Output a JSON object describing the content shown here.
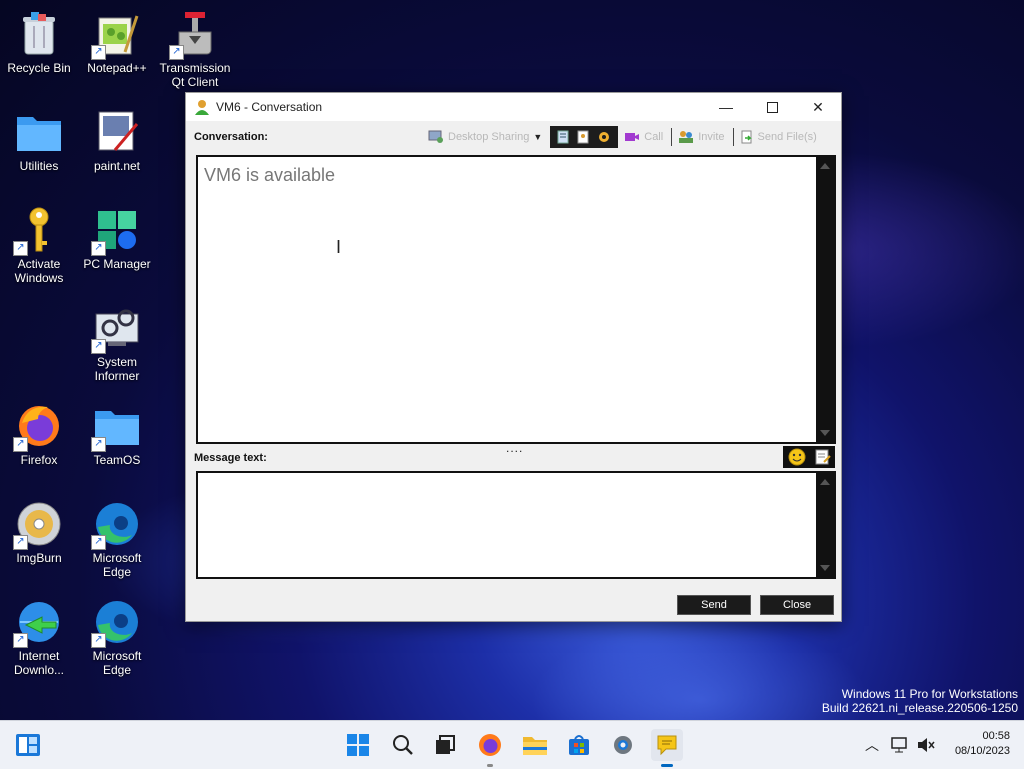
{
  "desktop": {
    "icons": [
      {
        "label": "Recycle Bin",
        "icon": "recycle-bin-icon"
      },
      {
        "label": "Notepad++",
        "icon": "notepad-plus-icon"
      },
      {
        "label": "Transmission Qt Client",
        "icon": "transmission-icon"
      },
      {
        "label": "Utilities",
        "icon": "folder-icon"
      },
      {
        "label": "paint.net",
        "icon": "paintnet-icon"
      },
      {
        "label": "Activate Windows",
        "icon": "key-icon"
      },
      {
        "label": "PC Manager",
        "icon": "pc-manager-icon"
      },
      {
        "label": "System Informer",
        "icon": "system-informer-icon"
      },
      {
        "label": "Firefox",
        "icon": "firefox-icon"
      },
      {
        "label": "TeamOS",
        "icon": "folder-icon"
      },
      {
        "label": "ImgBurn",
        "icon": "imgburn-icon"
      },
      {
        "label": "Microsoft Edge",
        "icon": "edge-icon"
      },
      {
        "label": "Internet Downlo...",
        "icon": "idm-icon"
      },
      {
        "label": "Microsoft Edge",
        "icon": "edge-icon"
      }
    ],
    "watermark_line1": "Windows 11 Pro for Workstations",
    "watermark_line2": "Build 22621.ni_release.220506-1250"
  },
  "window": {
    "title": "VM6 - Conversation",
    "conversation_label": "Conversation:",
    "message_label": "Message text:",
    "conversation_text": "VM6 is available",
    "message_value": "",
    "toolbar": {
      "desktop_sharing": "Desktop Sharing",
      "call": "Call",
      "invite": "Invite",
      "send_files": "Send File(s)"
    },
    "send_label": "Send",
    "close_label": "Close",
    "resize_grip": "...."
  },
  "taskbar": {
    "time": "00:58",
    "date": "08/10/2023"
  },
  "colors": {
    "window_bg": "#f0f0f0",
    "dark_button": "#1b1b1b",
    "taskbar_bg": "#eef1f7",
    "accent_blue": "#0067c0"
  }
}
